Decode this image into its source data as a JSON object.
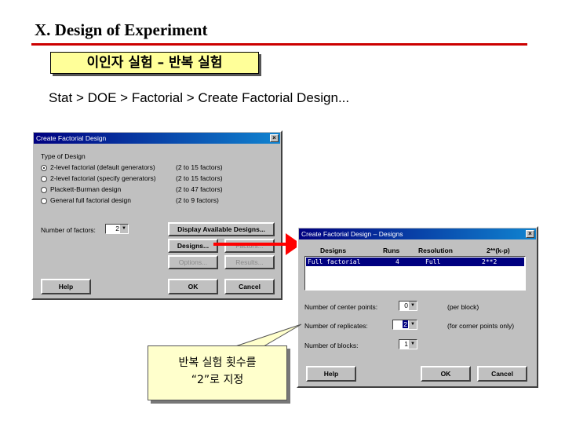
{
  "slide": {
    "title": "X. Design of Experiment",
    "subtitle": "이인자 실험 – 반복 실험",
    "menu_path": "Stat > DOE > Factorial > Create Factorial Design..."
  },
  "dialog1": {
    "title": "Create Factorial Design",
    "type_label": "Type of Design",
    "options": [
      {
        "label": "2-level factorial (default generators)",
        "range": "(2 to 15 factors)",
        "selected": true
      },
      {
        "label": "2-level factorial (specify generators)",
        "range": "(2 to 15 factors)",
        "selected": false
      },
      {
        "label": "Plackett-Burman design",
        "range": "(2 to 47 factors)",
        "selected": false
      },
      {
        "label": "General full factorial design",
        "range": "(2 to 9 factors)",
        "selected": false
      }
    ],
    "num_factors_label": "Number of factors:",
    "num_factors_value": "2",
    "buttons": {
      "display": "Display Available Designs...",
      "designs": "Designs...",
      "factors": "Factors...",
      "options": "Options...",
      "results": "Results...",
      "help": "Help",
      "ok": "OK",
      "cancel": "Cancel"
    }
  },
  "dialog2": {
    "title": "Create Factorial Design – Designs",
    "columns": {
      "designs": "Designs",
      "runs": "Runs",
      "resolution": "Resolution",
      "formula": "2**(k-p)"
    },
    "row": {
      "design": "Full factorial",
      "runs": "4",
      "resolution": "Full",
      "formula": "2**2"
    },
    "center_points_label": "Number of center points:",
    "center_points_value": "0",
    "center_points_note": "(per block)",
    "replicates_label": "Number of replicates:",
    "replicates_value": "2",
    "replicates_note": "(for corner points only)",
    "blocks_label": "Number of blocks:",
    "blocks_value": "1",
    "buttons": {
      "help": "Help",
      "ok": "OK",
      "cancel": "Cancel"
    }
  },
  "callout": {
    "line1": "반복 실험 횟수를",
    "line2": "“2”로 지정"
  },
  "colors": {
    "title_rule": "#cc0000",
    "highlight_box": "#ffff99",
    "arrow": "#ff0000",
    "window_bg": "#c0c0c0",
    "titlebar": "#000080"
  }
}
